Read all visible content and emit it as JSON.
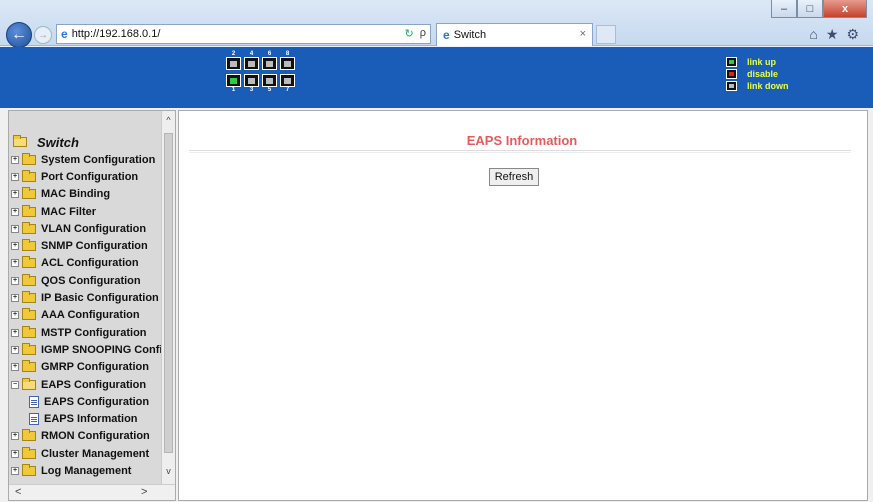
{
  "browser": {
    "url": "http://192.168.0.1/",
    "tab_title": "Switch",
    "win_minimize": "–",
    "win_maximize": "□",
    "win_close": "x",
    "back_glyph": "←",
    "forward_glyph": "→",
    "refresh_glyph": "↻",
    "search_glyph": "ρ",
    "tab_close": "×",
    "home_icon": "⌂",
    "favorites_icon": "★",
    "settings_icon": "⚙"
  },
  "banner": {
    "ports_top_labels": [
      "2",
      "4",
      "6",
      "8"
    ],
    "ports_bottom_labels": [
      "1",
      "3",
      "5",
      "7"
    ],
    "ports_top_state": [
      "down",
      "down",
      "down",
      "down"
    ],
    "ports_bottom_state": [
      "up",
      "down",
      "down",
      "down"
    ],
    "legend": {
      "up": "link up",
      "disable": "disable",
      "down": "link down"
    }
  },
  "sidebar": {
    "root_label": "Switch",
    "items": [
      {
        "label": "System Configuration",
        "expander": "+"
      },
      {
        "label": "Port Configuration",
        "expander": "+"
      },
      {
        "label": "MAC Binding",
        "expander": "+"
      },
      {
        "label": "MAC Filter",
        "expander": "+"
      },
      {
        "label": "VLAN Configuration",
        "expander": "+"
      },
      {
        "label": "SNMP Configuration",
        "expander": "+"
      },
      {
        "label": "ACL Configuration",
        "expander": "+"
      },
      {
        "label": "QOS Configuration",
        "expander": "+"
      },
      {
        "label": "IP Basic Configuration",
        "expander": "+"
      },
      {
        "label": "AAA Configuration",
        "expander": "+"
      },
      {
        "label": "MSTP Configuration",
        "expander": "+"
      },
      {
        "label": "IGMP SNOOPING Confi",
        "expander": "+"
      },
      {
        "label": "GMRP Configuration",
        "expander": "+"
      },
      {
        "label": "EAPS Configuration",
        "expander": "−"
      }
    ],
    "eaps_children": [
      "EAPS Configuration",
      "EAPS Information"
    ],
    "items_after": [
      {
        "label": "RMON Configuration",
        "expander": "+"
      },
      {
        "label": "Cluster Management",
        "expander": "+"
      },
      {
        "label": "Log Management",
        "expander": "+"
      }
    ],
    "scroll_up": "^",
    "scroll_down": "v",
    "scroll_left": "<",
    "scroll_right": ">"
  },
  "main": {
    "title": "EAPS Information",
    "refresh_label": "Refresh"
  },
  "colors": {
    "banner_bg": "#1a5db9",
    "title_color": "#e85a5a",
    "legend_text": "#e8ff44"
  }
}
